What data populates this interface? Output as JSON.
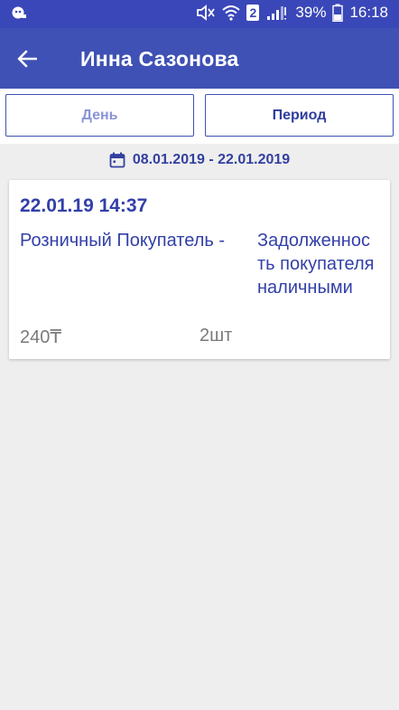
{
  "status_bar": {
    "battery": "39%",
    "time": "16:18",
    "sim_slot": "2",
    "icons": [
      "notification-icon",
      "mute-icon",
      "wifi-icon",
      "sim-icon",
      "signal-icon",
      "battery-icon"
    ]
  },
  "header": {
    "title": "Инна Сазонова",
    "back_icon": "arrow-back-icon"
  },
  "segments": {
    "day_label": "День",
    "period_label": "Период",
    "selected": "period"
  },
  "period": {
    "range": "08.01.2019 - 22.01.2019",
    "icon": "calendar-icon"
  },
  "transactions": [
    {
      "datetime": "22.01.19 14:37",
      "client": "Розничный Покупатель -",
      "description": "Задолженность покупателя наличными",
      "amount": "240₸",
      "quantity": "2шт"
    }
  ],
  "colors": {
    "primary": "#3f51b5",
    "status_bar": "#3a47b8",
    "accent_text": "#3340a8",
    "background": "#eeeeee"
  }
}
